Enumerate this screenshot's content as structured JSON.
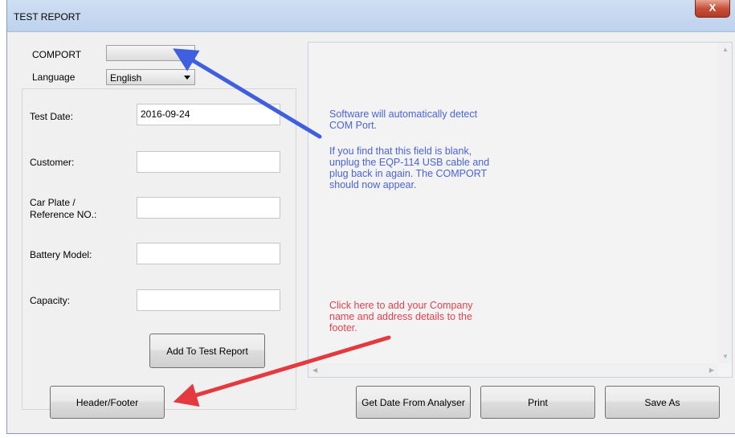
{
  "window": {
    "title": "TEST REPORT",
    "close_glyph": "X"
  },
  "comport": {
    "label": "COMPORT",
    "value": ""
  },
  "language": {
    "label": "Language",
    "value": "English"
  },
  "form": {
    "test_date_label": "Test Date:",
    "test_date_value": "2016-09-24",
    "customer_label": "Customer:",
    "customer_value": "",
    "car_plate_label_line1": "Car Plate /",
    "car_plate_label_line2": "Reference NO.:",
    "car_plate_value": "",
    "battery_model_label": "Battery Model:",
    "battery_model_value": "",
    "capacity_label": "Capacity:",
    "capacity_value": ""
  },
  "buttons": {
    "add_to_report": "Add To Test Report",
    "header_footer": "Header/Footer",
    "get_date": "Get Date From Analyser",
    "print": "Print",
    "save_as": "Save As"
  },
  "annotations": {
    "comport_note_line1": "Software will automatically detect",
    "comport_note_line2": "COM Port.",
    "comport_help_line1": "If you find that this field is blank,",
    "comport_help_line2": "unplug the EQP-114 USB cable and",
    "comport_help_line3": "plug back in again. The COMPORT",
    "comport_help_line4": "should now appear.",
    "footer_note_line1": "Click here to add your Company",
    "footer_note_line2": "name and address details to the",
    "footer_note_line3": "footer."
  },
  "colors": {
    "blue_annotation": "#4a63d9",
    "red_annotation": "#e4414f"
  }
}
